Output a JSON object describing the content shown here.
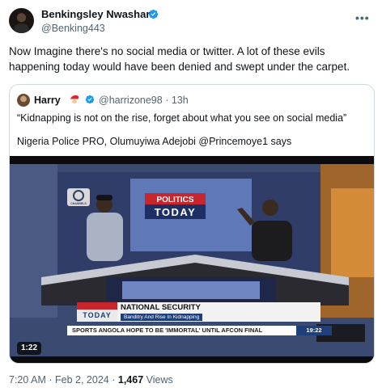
{
  "tweet": {
    "author_name": "Benkingsley Nwashara",
    "author_handle": "@Benking443",
    "text": "Now Imagine there's no social media or twitter. A lot of these evils happening today would have been denied and swept under the carpet.",
    "time": "7:20 AM",
    "separator": "·",
    "date": "Feb 2, 2024",
    "views_count": "1,467",
    "views_label": "Views"
  },
  "quoted_tweet": {
    "author_name": "Harry",
    "author_handle": "@harrizone98",
    "separator": "·",
    "time_ago": "13h",
    "line1": "“Kidnapping is not on the rise, forget about what you see on social media”",
    "line2": "Nigeria Police PRO, Olumuyiwa Adejobi @Princemoye1 says"
  },
  "video": {
    "duration": "1:22",
    "studio_title_top": "POLITICS",
    "studio_title_bottom": "TODAY",
    "channel_logo": "CHANNELS",
    "lower_third": {
      "show_logo": "TODAY",
      "headline": "NATIONAL SECURITY",
      "subheadline": "Banditry And Rise In Kidnapping"
    },
    "ticker": {
      "text": "SPORTS   ANGOLA HOPE TO BE 'IMMORTAL' UNTIL AFCON FINAL",
      "clock": "19:22"
    }
  },
  "icons": {
    "verified": "verified-badge-icon",
    "more": "more-options-icon",
    "emoji": "santa-emoji-icon"
  },
  "colors": {
    "verified_blue": "#1d9bf0",
    "secondary_text": "#536471",
    "border": "#cfd9de"
  }
}
